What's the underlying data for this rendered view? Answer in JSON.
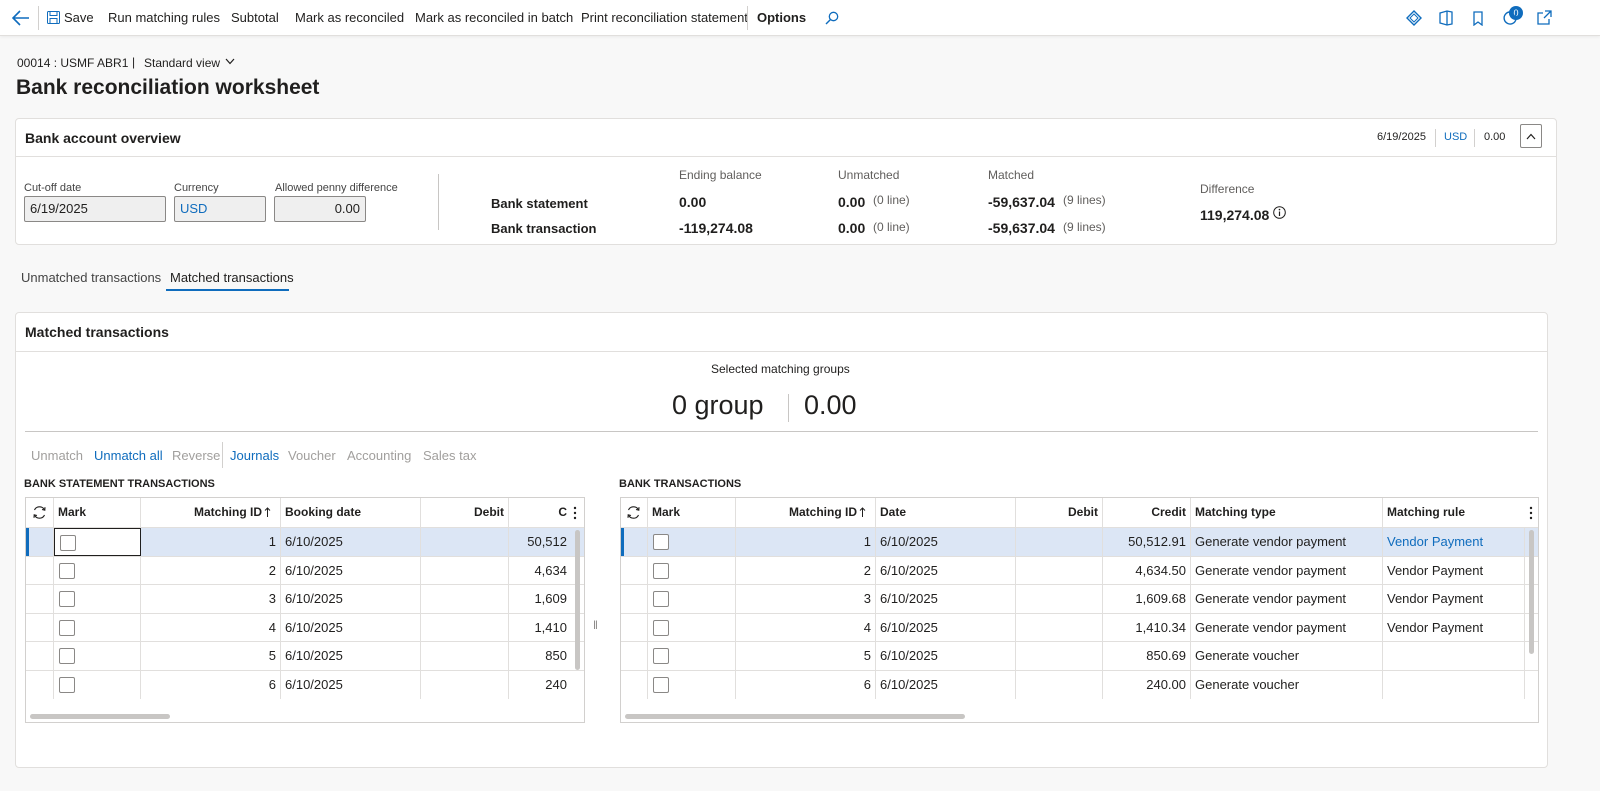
{
  "toolbar": {
    "save": "Save",
    "run_matching_rules": "Run matching rules",
    "subtotal": "Subtotal",
    "mark_reconciled": "Mark as reconciled",
    "mark_reconciled_batch": "Mark as reconciled in batch",
    "print_statement": "Print reconciliation statement",
    "options": "Options",
    "notification_count": "0"
  },
  "header": {
    "breadcrumb": "00014 : USMF ABR1",
    "separator": "|",
    "view": "Standard view",
    "title": "Bank reconciliation worksheet"
  },
  "overview": {
    "title": "Bank account overview",
    "summary_date": "6/19/2025",
    "summary_currency": "USD",
    "summary_amount": "0.00",
    "cutoff_label": "Cut-off date",
    "cutoff_value": "6/19/2025",
    "currency_label": "Currency",
    "currency_value": "USD",
    "penny_label": "Allowed penny difference",
    "penny_value": "0.00",
    "col_ending": "Ending balance",
    "col_unmatched": "Unmatched",
    "col_matched": "Matched",
    "row_statement": "Bank statement",
    "row_transaction": "Bank transaction",
    "stmt_ending": "0.00",
    "stmt_unmatched": "0.00",
    "stmt_unmatched_lines": "(0 line)",
    "stmt_matched": "-59,637.04",
    "stmt_matched_lines": "(9 lines)",
    "tx_ending": "-119,274.08",
    "tx_unmatched": "0.00",
    "tx_unmatched_lines": "(0 line)",
    "tx_matched": "-59,637.04",
    "tx_matched_lines": "(9 lines)",
    "difference_label": "Difference",
    "difference_value": "119,274.08"
  },
  "tabs": {
    "unmatched": "Unmatched transactions",
    "matched": "Matched transactions"
  },
  "matched": {
    "title": "Matched transactions",
    "selected_label": "Selected matching groups",
    "group_count": "0 group",
    "group_amount": "0.00",
    "actions": {
      "unmatch": "Unmatch",
      "unmatch_all": "Unmatch all",
      "reverse": "Reverse",
      "journals": "Journals",
      "voucher": "Voucher",
      "accounting": "Accounting",
      "sales_tax": "Sales tax"
    }
  },
  "stmt_grid": {
    "title": "BANK STATEMENT TRANSACTIONS",
    "columns": [
      "Mark",
      "Matching ID",
      "Booking date",
      "Debit",
      "C"
    ],
    "rows": [
      {
        "id": "1",
        "date": "6/10/2025",
        "debit": "",
        "credit": "50,512"
      },
      {
        "id": "2",
        "date": "6/10/2025",
        "debit": "",
        "credit": "4,634"
      },
      {
        "id": "3",
        "date": "6/10/2025",
        "debit": "",
        "credit": "1,609"
      },
      {
        "id": "4",
        "date": "6/10/2025",
        "debit": "",
        "credit": "1,410"
      },
      {
        "id": "5",
        "date": "6/10/2025",
        "debit": "",
        "credit": "850"
      },
      {
        "id": "6",
        "date": "6/10/2025",
        "debit": "",
        "credit": "240"
      }
    ]
  },
  "tx_grid": {
    "title": "BANK TRANSACTIONS",
    "columns": [
      "Mark",
      "Matching ID",
      "Date",
      "Debit",
      "Credit",
      "Matching type",
      "Matching rule"
    ],
    "rows": [
      {
        "id": "1",
        "date": "6/10/2025",
        "debit": "",
        "credit": "50,512.91",
        "type": "Generate vendor payment",
        "rule": "Vendor Payment"
      },
      {
        "id": "2",
        "date": "6/10/2025",
        "debit": "",
        "credit": "4,634.50",
        "type": "Generate vendor payment",
        "rule": "Vendor Payment"
      },
      {
        "id": "3",
        "date": "6/10/2025",
        "debit": "",
        "credit": "1,609.68",
        "type": "Generate vendor payment",
        "rule": "Vendor Payment"
      },
      {
        "id": "4",
        "date": "6/10/2025",
        "debit": "",
        "credit": "1,410.34",
        "type": "Generate vendor payment",
        "rule": "Vendor Payment"
      },
      {
        "id": "5",
        "date": "6/10/2025",
        "debit": "",
        "credit": "850.69",
        "type": "Generate voucher",
        "rule": ""
      },
      {
        "id": "6",
        "date": "6/10/2025",
        "debit": "",
        "credit": "240.00",
        "type": "Generate voucher",
        "rule": ""
      }
    ]
  },
  "colors": {
    "accent": "#0f6cbd",
    "selected_row": "#dce6f5"
  },
  "icons": [
    "back-arrow-icon",
    "save-icon",
    "search-icon",
    "diamond-icon",
    "office-icon",
    "notification-icon",
    "refresh-icon",
    "open-new-window-icon",
    "chevron-down-icon",
    "chevron-up-icon",
    "info-icon",
    "sort-up-icon",
    "more-icon"
  ]
}
